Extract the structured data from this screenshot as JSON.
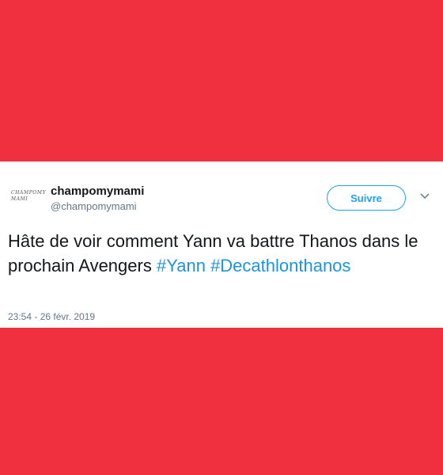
{
  "colors": {
    "background": "#f1303f",
    "card": "#ffffff",
    "accent": "#1da1f2",
    "hashtag": "#1b95e0",
    "text": "#14171a",
    "muted": "#657786"
  },
  "tweet": {
    "avatar_text_line1": "CHAMPOMY",
    "avatar_text_line2": "MAMI",
    "author_name": "champomymami",
    "author_handle": "@champomymami",
    "follow_label": "Suivre",
    "menu_icon": "chevron-down-icon",
    "text_part1": "Hâte de voir comment Yann va battre Thanos dans le prochain Avengers ",
    "hashtag1": "#Yann",
    "text_space": " ",
    "hashtag2": "#Decathlonthanos",
    "date": "23:54 - 26 févr. 2019"
  }
}
